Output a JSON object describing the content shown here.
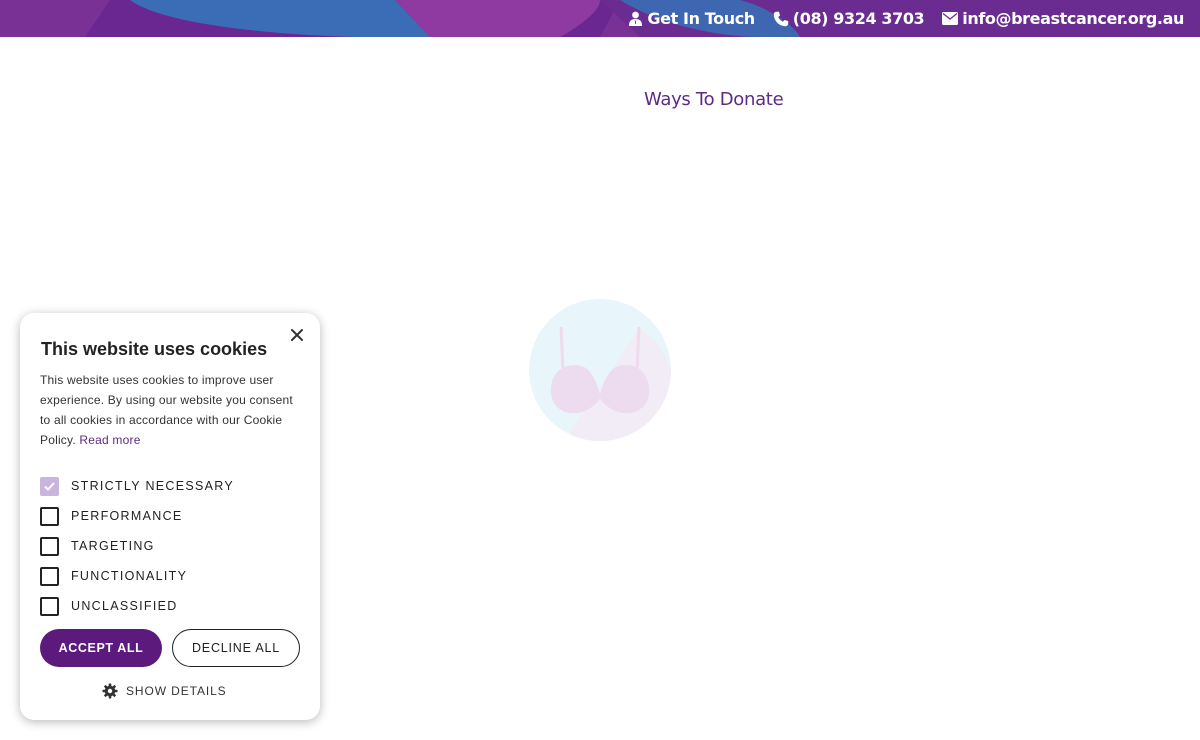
{
  "topbar": {
    "links": [
      {
        "label": "Get In Touch",
        "icon": "user-icon"
      },
      {
        "label": "(08) 9324 3703",
        "icon": "phone-icon"
      },
      {
        "label": "info@breastcancer.org.au",
        "icon": "envelope-icon"
      }
    ],
    "colors": {
      "purple": "#6a2c91",
      "blue": "#3a6db5",
      "magenta": "#8e3aa0"
    }
  },
  "main": {
    "ways_to_donate": "Ways To Donate",
    "loader_icon": "bra-logo-icon"
  },
  "cookie": {
    "title": "This website uses cookies",
    "description": "This website uses cookies to improve user experience. By using our website you consent to all cookies in accordance with our Cookie Policy.",
    "read_more": "Read more",
    "options": [
      {
        "label": "STRICTLY NECESSARY",
        "checked": true
      },
      {
        "label": "PERFORMANCE",
        "checked": false
      },
      {
        "label": "TARGETING",
        "checked": false
      },
      {
        "label": "FUNCTIONALITY",
        "checked": false
      },
      {
        "label": "UNCLASSIFIED",
        "checked": false
      }
    ],
    "accept_label": "ACCEPT ALL",
    "decline_label": "DECLINE ALL",
    "details_label": "SHOW DETAILS",
    "accent": "#5b1a7c"
  }
}
